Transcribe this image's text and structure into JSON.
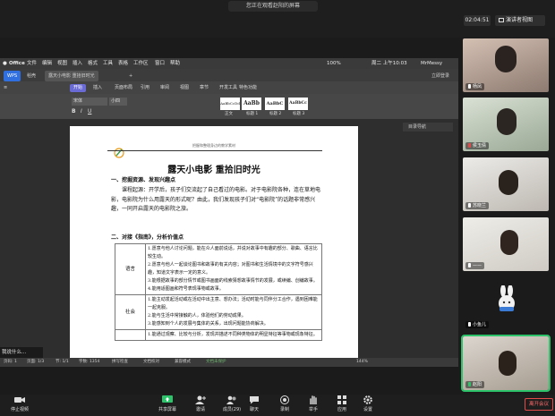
{
  "meeting": {
    "share_banner": "您正在观看赵阳的屏幕",
    "timer": "02:04:51",
    "view_switch": "演讲者视图"
  },
  "mac_menu": {
    "app": "Office",
    "items": [
      "文件",
      "编辑",
      "视图",
      "插入",
      "格式",
      "工具",
      "表格",
      "工作区",
      "窗口",
      "帮助"
    ],
    "status": [
      "100%",
      "周二 上午10:03",
      "MrMessy"
    ]
  },
  "wps": {
    "tabs": [
      "WPS",
      "稻壳",
      "露天小电影 重拾旧时光",
      "+"
    ],
    "login": "立即登录",
    "ribbon": [
      "开始",
      "插入",
      "页面布局",
      "引用",
      "审阅",
      "视图",
      "章节",
      "开发工具",
      "特色功能"
    ],
    "font_name": "宋体",
    "font_size": "小四",
    "styles": [
      {
        "sample": "AaBbCcDd",
        "label": "正文"
      },
      {
        "sample": "AaBb",
        "label": "标题 1"
      },
      {
        "sample": "AaBbC",
        "label": "标题 2"
      },
      {
        "sample": "AaBbCc",
        "label": "标题 3"
      }
    ],
    "nav_panel": "目录导航"
  },
  "document": {
    "header_note": "把握和整理身边的教学素材",
    "title": "露天小电影  重拾旧时光",
    "h1": "一、挖掘资源、发现兴趣点",
    "p1": "课程起源：开学后，孩子们交流起了自己看过的电影。对于电影院各种，连在草地电影，电影院为什么用露天的形式呢？由此，我们发现孩子们对“电影院”的话题非常感兴趣，一同开启露天的电影院之旅。",
    "h2": "二、对接《指南》，分析价值点",
    "table": [
      {
        "key": "语言",
        "lines": [
          "1.愿意与他人讨论问题，能在众人面前说话，并说对故事中有趣的部分、歌曲、语言比较生动。",
          "2.愿意与他人一起谈论图书和故事的有关内容；对图书和生活情境中的文字符号感兴趣，知道文字表示一定的意义。",
          "3.能根据故事的部分情节或图书画面的线索猜想故事情节的发展，或续编、创编故事。",
          "4.能用适图画和符号表现事物或故事。"
        ]
      },
      {
        "key": "社会",
        "lines": [
          "1.能主动发起活动或在活动中出主意、想办法；活动时能与同伴分工合作，遇到困难能一起克服。",
          "2.能与生活中常接触的人，体验他们的劳动成果。",
          "3.能感知到个人的发展与集体的关系，出现问题能协商解决。"
        ]
      },
      {
        "key": "",
        "lines": [
          "1.能通过观察、比较与分析，发现并描述不同种类物体的明显特征等事物或现象特征。"
        ]
      }
    ]
  },
  "doc_status": {
    "page": "页码: 1",
    "pages": "页面: 1/3",
    "section": "节: 1/1",
    "words": "字数: 1354",
    "spell": "拼写检查",
    "proof": "文档校对",
    "compat": "兼容模式",
    "backup": "文档未保护",
    "zoom": "144%"
  },
  "caption_snippet": "我说什么...",
  "participants": [
    {
      "name": "杨凤",
      "muted": false,
      "color": "#b9a59a"
    },
    {
      "name": "侯玉倩",
      "muted": true,
      "color": "#c5cfc0"
    },
    {
      "name": "苏晓兰",
      "muted": false,
      "color": "#d5d1cc"
    },
    {
      "name": "——",
      "muted": false,
      "color": "#d8d7d2"
    },
    {
      "name": "小鱼儿",
      "muted": false,
      "color": "#ececec"
    },
    {
      "name": "赵阳",
      "muted": false,
      "color": "#c9c4bd"
    }
  ],
  "controls": [
    {
      "label": "停止视频",
      "icon": "camera-icon"
    },
    {
      "label": "共享屏幕",
      "icon": "share-screen-icon"
    },
    {
      "label": "邀请",
      "icon": "invite-icon"
    },
    {
      "label": "成员(29)",
      "icon": "members-icon"
    },
    {
      "label": "聊天",
      "icon": "chat-icon"
    },
    {
      "label": "录制",
      "icon": "record-icon"
    },
    {
      "label": "举手",
      "icon": "raise-hand-icon"
    },
    {
      "label": "应用",
      "icon": "apps-icon"
    },
    {
      "label": "设置",
      "icon": "settings-icon"
    }
  ],
  "leave": "离开会议",
  "colors": {
    "accent": "#6b6bd6",
    "active_speaker": "#2cc36b",
    "leave": "#e34b4b"
  }
}
